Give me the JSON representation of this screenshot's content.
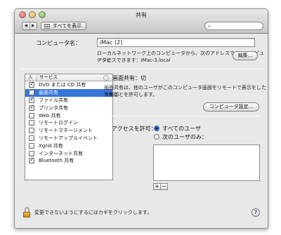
{
  "window": {
    "title": "共有"
  },
  "toolbar": {
    "back_label": "◀",
    "forward_label": "▶",
    "show_all_label": "すべてを表示",
    "search_value": ""
  },
  "computer_name": {
    "label": "コンピュータ名：",
    "value": "iMac (2)",
    "description_line1": "ローカルネットワーク上のコンピュータから、次のアドレスでこのコンピュータに",
    "description_line2": "アクセスできます：iMac-3.local",
    "edit_label": "編集..."
  },
  "services": {
    "header_on": "入",
    "header_service": "サービス",
    "items": [
      {
        "label": "DVD または CD 共有",
        "checked": true,
        "selected": false
      },
      {
        "label": "画面共有",
        "checked": false,
        "selected": true
      },
      {
        "label": "ファイル共有",
        "checked": true,
        "selected": false
      },
      {
        "label": "プリンタ共有",
        "checked": true,
        "selected": false
      },
      {
        "label": "Web 共有",
        "checked": false,
        "selected": false
      },
      {
        "label": "リモートログイン",
        "checked": false,
        "selected": false
      },
      {
        "label": "リモートマネージメント",
        "checked": false,
        "selected": false
      },
      {
        "label": "リモートアップルイベント",
        "checked": false,
        "selected": false
      },
      {
        "label": "Xgrid 共有",
        "checked": false,
        "selected": false
      },
      {
        "label": "インターネット共有",
        "checked": false,
        "selected": false
      },
      {
        "label": "Bluetooth 共有",
        "checked": true,
        "selected": false
      }
    ]
  },
  "detail": {
    "status": "画面共有：切",
    "description_line1": "画面共有は、他のユーザがこのコンピュータ画面をリモートで表示をしたり制御",
    "description_line2": "することを許可します。",
    "settings_button": "コンピュータ設定...",
    "access_label": "アクセスを許可：",
    "option_all": "すべてのユーザ",
    "option_only": "次のユーザのみ：",
    "selected_option": "all",
    "add_label": "+",
    "remove_label": "−"
  },
  "footer": {
    "lock_text": "変更できないようにするにはカギをクリックします。",
    "help_label": "?"
  }
}
